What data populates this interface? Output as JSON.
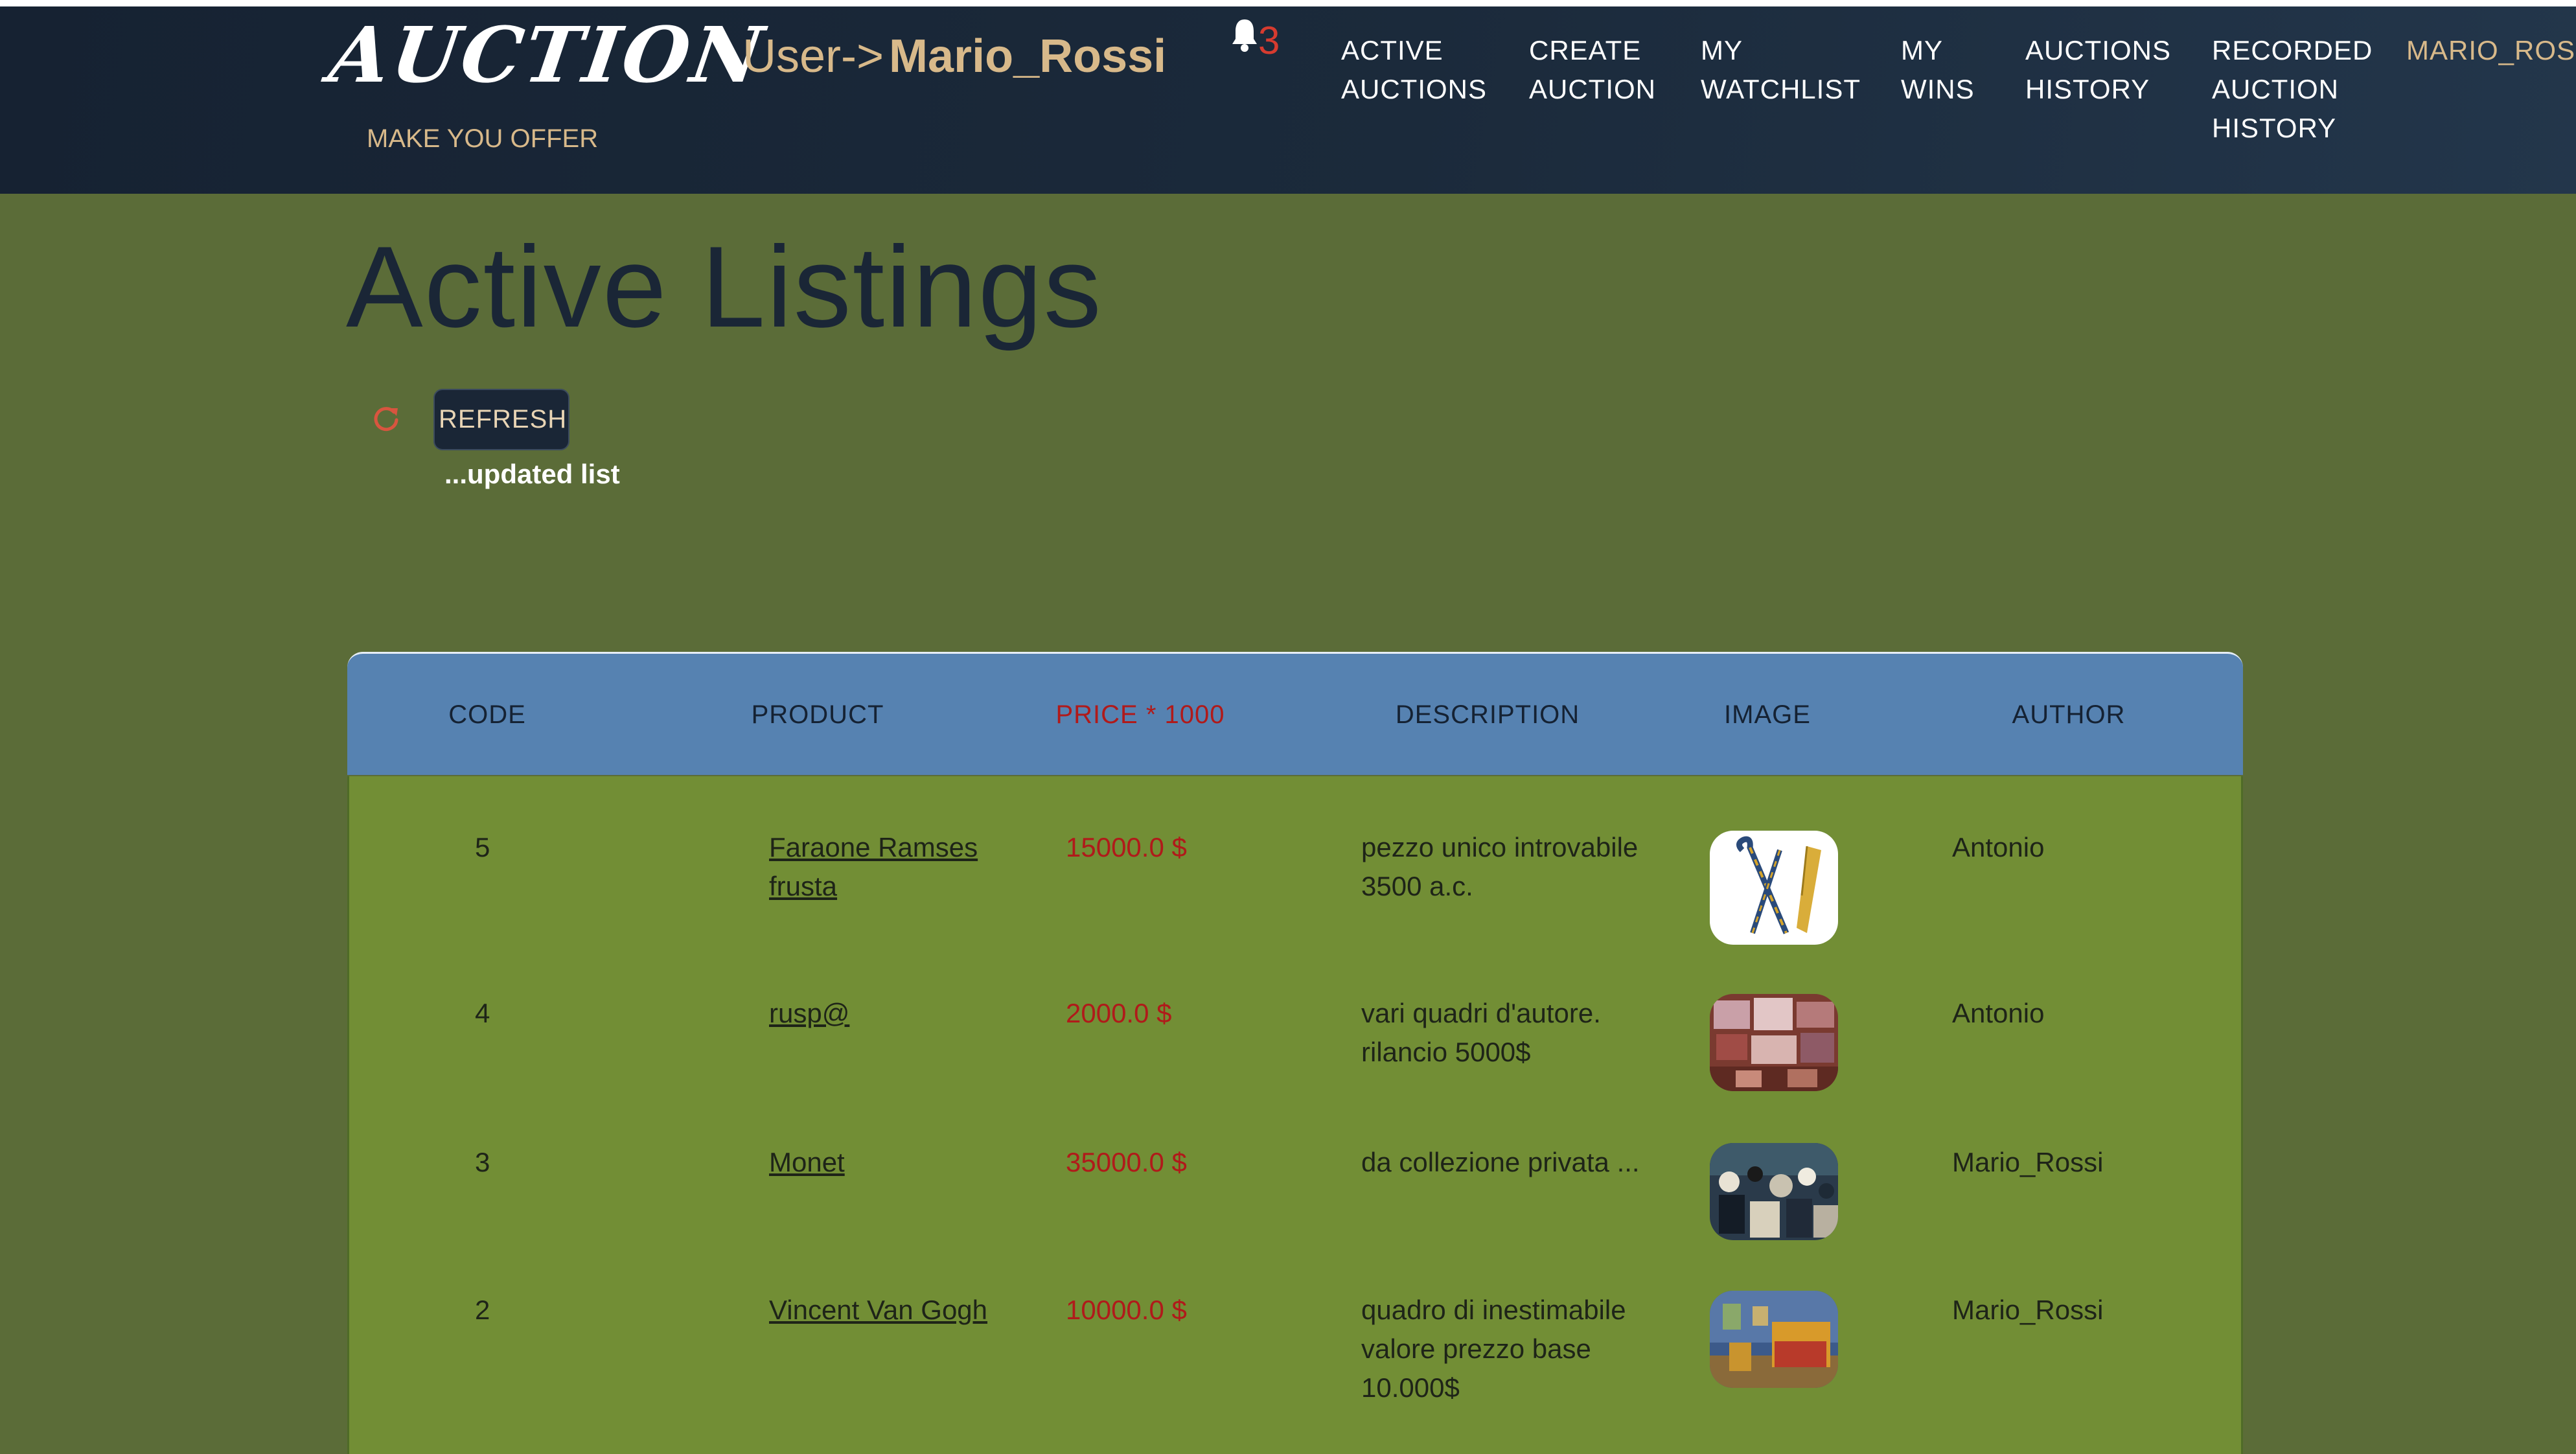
{
  "header": {
    "brand": "AUCTION",
    "user_label": "User->",
    "user_name": "Mario_Rossi",
    "tagline": "MAKE YOU OFFER",
    "notification_count": "3",
    "nav": [
      {
        "line1": "ACTIVE",
        "line2": "AUCTIONS",
        "line3": ""
      },
      {
        "line1": "CREATE",
        "line2": "AUCTION",
        "line3": ""
      },
      {
        "line1": "MY",
        "line2": "WATCHLIST",
        "line3": ""
      },
      {
        "line1": "MY",
        "line2": "WINS",
        "line3": ""
      },
      {
        "line1": "AUCTIONS",
        "line2": "HISTORY",
        "line3": ""
      },
      {
        "line1": "RECORDED",
        "line2": "AUCTION",
        "line3": "HISTORY"
      }
    ],
    "nav_user": "MARIO_ROSSI"
  },
  "main": {
    "title": "Active Listings",
    "refresh_label": "REFRESH",
    "refresh_note": "...updated list"
  },
  "table": {
    "columns": [
      "CODE",
      "PRODUCT",
      "PRICE * 1000",
      "DESCRIPTION",
      "IMAGE",
      "AUTHOR"
    ],
    "rows": [
      {
        "code": "5",
        "product": "Faraone Ramses frusta",
        "price": "15000.0 $",
        "description": "pezzo unico introvabile 3500 a.c.",
        "image": "crook-and-flail",
        "author": "Antonio"
      },
      {
        "code": "4",
        "product": "rusp@",
        "price": "2000.0 $",
        "description": "vari quadri d'autore. rilancio 5000$",
        "image": "paintings-collage",
        "author": "Antonio"
      },
      {
        "code": "3",
        "product": "Monet",
        "price": "35000.0 $",
        "description": "da collezione privata ...",
        "image": "crowd-painting",
        "author": "Mario_Rossi"
      },
      {
        "code": "2",
        "product": "Vincent Van Gogh",
        "price": "10000.0 $",
        "description": "quadro di inestimabile valore prezzo base 10.000$",
        "image": "bedroom-painting",
        "author": "Mario_Rossi"
      }
    ]
  },
  "colors": {
    "page_bg": "#5b6c38",
    "header_bg": "#1b2a3b",
    "accent_gold": "#d8b98a",
    "table_head_bg": "#5682b1",
    "table_body_bg": "#728e35",
    "price_red": "#b01a1a",
    "notification_red": "#d63b2f"
  },
  "icons": {
    "notification": "bell-icon",
    "refresh": "refresh-icon"
  }
}
